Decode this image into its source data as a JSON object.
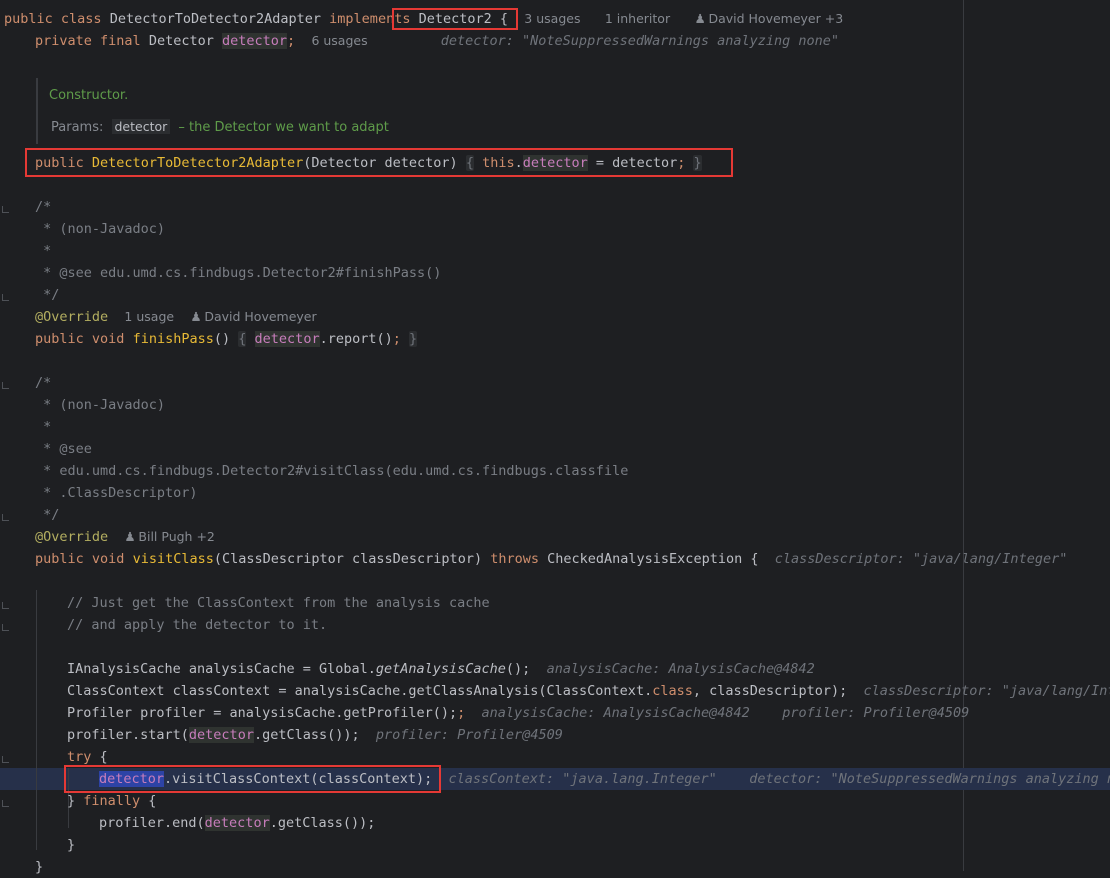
{
  "class_decl": {
    "kw_public": "public",
    "kw_class": "class",
    "class_name": "DetectorToDetector2Adapter",
    "kw_implements": "implements",
    "interface_name": "Detector2",
    "open_brace": "{",
    "usages": "3 usages",
    "inheritors": "1 inheritor",
    "authors": "David Hovemeyer +3"
  },
  "field_decl": {
    "kw_private": "private",
    "kw_final": "final",
    "type": "Detector",
    "name": "detector",
    "semicolon": ";",
    "usages": "6 usages",
    "hint": "detector: \"NoteSuppressedWarnings analyzing none\""
  },
  "javadoc": {
    "title": "Constructor.",
    "params_label": "Params:",
    "param_name": "detector",
    "param_desc": "– the Detector we want to adapt"
  },
  "constructor": {
    "kw_public": "public",
    "name": "DetectorToDetector2Adapter",
    "params": "(Detector detector)",
    "body_open": "{",
    "kw_this": "this",
    "dot": ".",
    "field": "detector",
    "assign": " = detector",
    "semicolon": ";",
    "body_close": "}"
  },
  "comment1": {
    "l1": "/*",
    "l2": " * (non-Javadoc)",
    "l3": " *",
    "l4": " * @see edu.umd.cs.findbugs.Detector2#finishPass()",
    "l5": " */"
  },
  "finish_pass": {
    "annotation": "@Override",
    "usages": "1 usage",
    "author": "David Hovemeyer",
    "kw_public": "public",
    "kw_void": "void",
    "name": "finishPass",
    "parens": "()",
    "body_open": "{",
    "field": "detector",
    "call": ".report()",
    "semicolon": ";",
    "body_close": "}"
  },
  "comment2": {
    "l1": "/*",
    "l2": " * (non-Javadoc)",
    "l3": " *",
    "l4": " * @see",
    "l5": " * edu.umd.cs.findbugs.Detector2#visitClass(edu.umd.cs.findbugs.classfile",
    "l6": " * .ClassDescriptor)",
    "l7": " */"
  },
  "visit_class": {
    "annotation": "@Override",
    "author": "Bill Pugh +2",
    "kw_public": "public",
    "kw_void": "void",
    "name": "visitClass",
    "params": "(ClassDescriptor classDescriptor)",
    "kw_throws": "throws",
    "exception": "CheckedAnalysisException {",
    "hint": "classDescriptor: \"java/lang/Integer\""
  },
  "body": {
    "c1": "// Just get the ClassContext from the analysis cache",
    "c2": "// and apply the detector to it.",
    "l1_pre": "IAnalysisCache analysisCache = Global.",
    "l1_method": "getAnalysisCache",
    "l1_post": "();",
    "l1_hint": "analysisCache: AnalysisCache@4842",
    "l2_pre": "ClassContext classContext = analysisCache.getClassAnalysis(ClassContext.",
    "l2_kw": "class",
    "l2_post": ", classDescriptor);",
    "l2_hint": "classDescriptor: \"java/lang/Integer\"",
    "l3_code": "Profiler profiler = analysisCache.getProfiler();",
    "l3_hint1": "analysisCache: AnalysisCache@4842",
    "l3_hint2": "profiler: Profiler@4509",
    "l4_pre": "profiler.start(",
    "l4_field": "detector",
    "l4_post": ".getClass());",
    "l4_hint": "profiler: Profiler@4509",
    "try_kw": "try",
    "try_brace": " {",
    "l5_field": "detector",
    "l5_post": ".visitClassContext(classContext);",
    "l5_hint1": "classContext: \"java.lang.Integer\"",
    "l5_hint2": "detector: \"NoteSuppressedWarnings analyzing none\"",
    "finally_pre": "} ",
    "finally_kw": "finally",
    "finally_brace": " {",
    "l6_pre": "profiler.end(",
    "l6_field": "detector",
    "l6_post": ".getClass());",
    "close1": "}",
    "close2": "}"
  }
}
